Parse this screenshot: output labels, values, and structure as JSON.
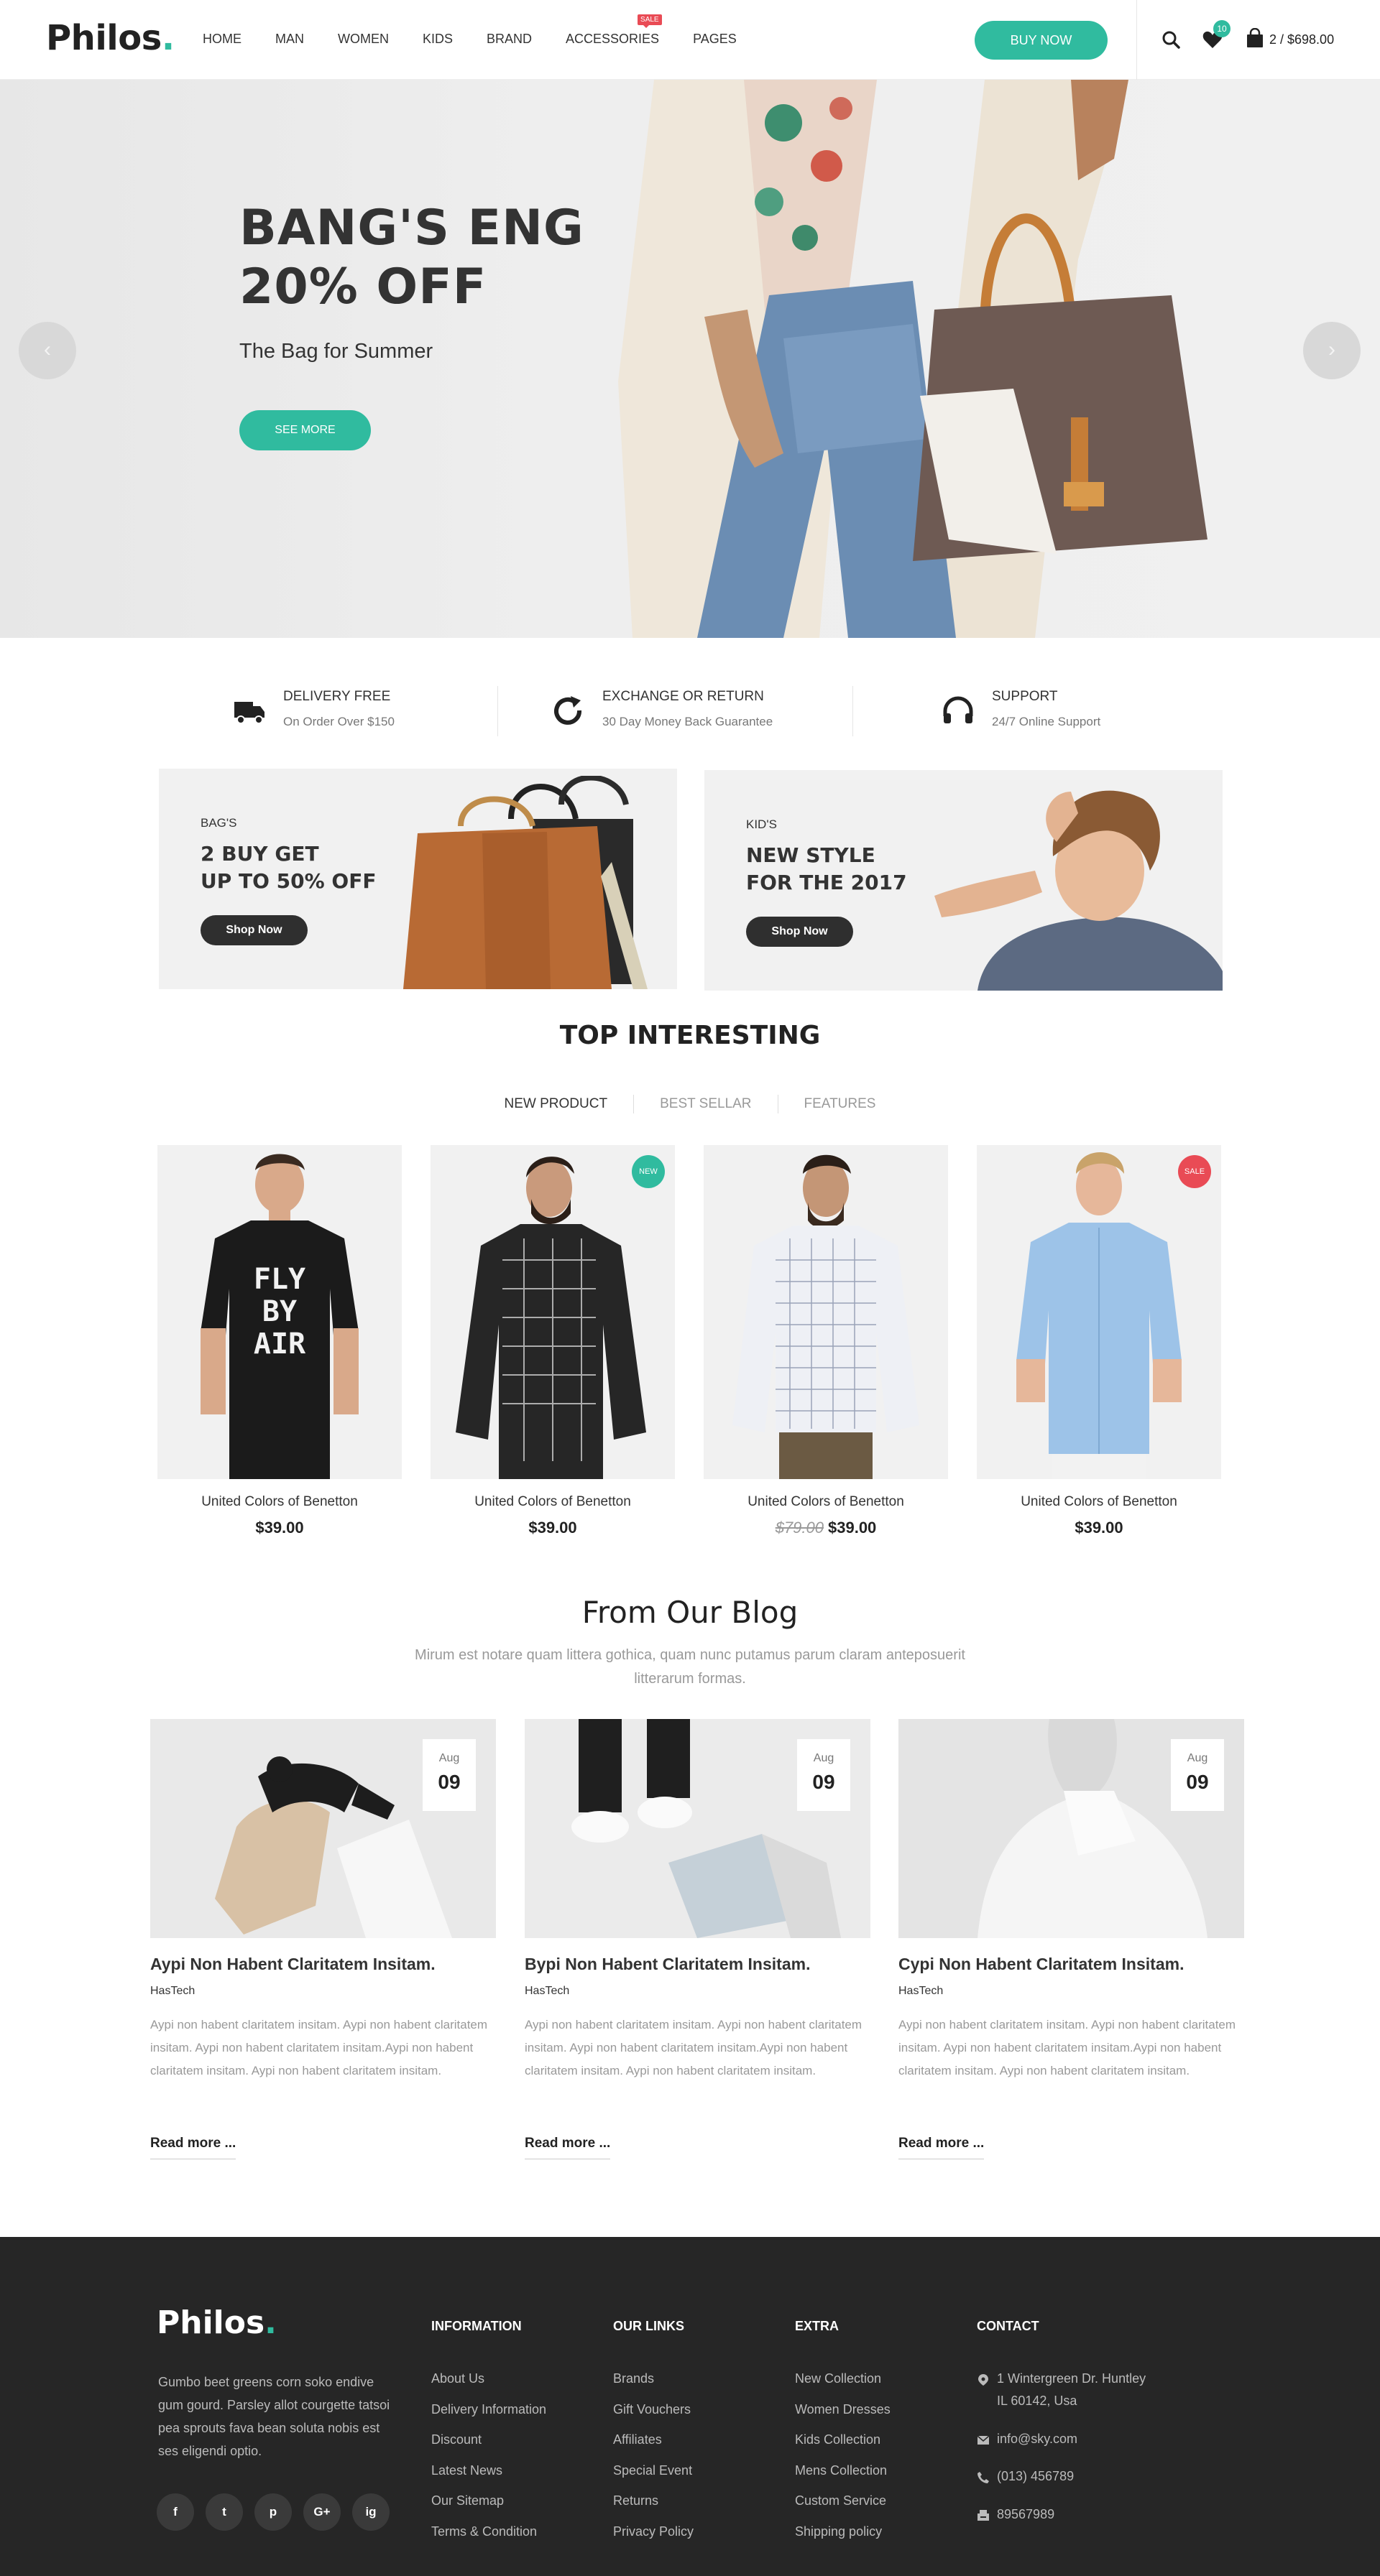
{
  "header": {
    "logo": "Philos",
    "logo_dot": ".",
    "nav": [
      "HOME",
      "MAN",
      "WOMEN",
      "KIDS",
      "BRAND",
      "ACCESSORIES",
      "PAGES"
    ],
    "sale_tag": "SALE",
    "buy_now": "BUY NOW",
    "wishlist_count": "10",
    "cart_summary": "2 / $698.00"
  },
  "hero": {
    "title_line1": "BANG'S ENG",
    "title_line2": "20% OFF",
    "subtitle": "The Bag for Summer",
    "button": "SEE MORE",
    "prev": "‹",
    "next": "›"
  },
  "features": [
    {
      "title": "DELIVERY FREE",
      "desc": "On Order Over $150",
      "icon": "truck-icon"
    },
    {
      "title": "EXCHANGE OR RETURN",
      "desc": "30 Day Money Back Guarantee",
      "icon": "refresh-icon"
    },
    {
      "title": "SUPPORT",
      "desc": "24/7 Online Support",
      "icon": "headphones-icon"
    }
  ],
  "banners": [
    {
      "tag": "BAG'S",
      "title_line1": "2 BUY GET",
      "title_line2": "UP TO 50% OFF",
      "button": "Shop Now"
    },
    {
      "tag": "KID'S",
      "title_line1": "NEW STYLE",
      "title_line2": "FOR THE 2017",
      "button": "Shop Now"
    }
  ],
  "top_interesting": {
    "title": "TOP INTERESTING",
    "tabs": [
      "NEW PRODUCT",
      "BEST SELLAR",
      "FEATURES"
    ]
  },
  "products": [
    {
      "name": "United Colors of Benetton",
      "price": "$39.00",
      "old_price": "",
      "badge": "",
      "shirt_text": "FLY BY AIR"
    },
    {
      "name": "United Colors of Benetton",
      "price": "$39.00",
      "old_price": "",
      "badge": "NEW"
    },
    {
      "name": "United Colors of Benetton",
      "price": "$39.00",
      "old_price": "$79.00",
      "badge": ""
    },
    {
      "name": "United Colors of Benetton",
      "price": "$39.00",
      "old_price": "",
      "badge": "SALE"
    }
  ],
  "blog": {
    "title": "From Our Blog",
    "subtitle": "Mirum est notare quam littera gothica, quam nunc putamus parum claram anteposuerit litterarum formas.",
    "posts": [
      {
        "month": "Aug",
        "day": "09",
        "title": "Aypi Non Habent Claritatem Insitam.",
        "author": "HasTech",
        "excerpt": "Aypi non habent claritatem insitam. Aypi non habent claritatem insitam. Aypi non habent claritatem insitam.Aypi non habent claritatem insitam. Aypi non habent claritatem insitam.",
        "more": "Read more ..."
      },
      {
        "month": "Aug",
        "day": "09",
        "title": "Bypi Non Habent Claritatem Insitam.",
        "author": "HasTech",
        "excerpt": "Aypi non habent claritatem insitam. Aypi non habent claritatem insitam. Aypi non habent claritatem insitam.Aypi non habent claritatem insitam. Aypi non habent claritatem insitam.",
        "more": "Read more ..."
      },
      {
        "month": "Aug",
        "day": "09",
        "title": "Cypi Non Habent Claritatem Insitam.",
        "author": "HasTech",
        "excerpt": "Aypi non habent claritatem insitam. Aypi non habent claritatem insitam. Aypi non habent claritatem insitam.Aypi non habent claritatem insitam. Aypi non habent claritatem insitam.",
        "more": "Read more ..."
      }
    ]
  },
  "footer": {
    "logo": "Philos",
    "logo_dot": ".",
    "description": "Gumbo beet greens corn soko endive gum gourd. Parsley allot courgette tatsoi pea sprouts fava bean soluta nobis est ses eligendi optio.",
    "social": [
      "f",
      "t",
      "p",
      "G+",
      "ig"
    ],
    "columns": [
      {
        "heading": "INFORMATION",
        "links": [
          "About Us",
          "Delivery Information",
          "Discount",
          "Latest News",
          "Our Sitemap",
          "Terms & Condition"
        ]
      },
      {
        "heading": "OUR LINKS",
        "links": [
          "Brands",
          "Gift Vouchers",
          "Affiliates",
          "Special Event",
          "Returns",
          "Privacy Policy"
        ]
      },
      {
        "heading": "EXTRA",
        "links": [
          "New Collection",
          "Women Dresses",
          "Kids Collection",
          "Mens Collection",
          "Custom Service",
          "Shipping policy"
        ]
      }
    ],
    "contact": {
      "heading": "CONTACT",
      "address_line1": "1 Wintergreen Dr. Huntley",
      "address_line2": "IL 60142, Usa",
      "email": "info@sky.com",
      "phone": "(013) 456789",
      "fax": "89567989"
    }
  },
  "colors": {
    "accent": "#30bb9f",
    "sale": "#e94b55",
    "dark": "#262626"
  }
}
